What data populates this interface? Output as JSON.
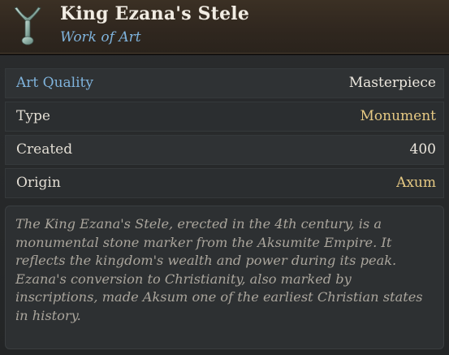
{
  "header": {
    "icon": "stele-monument-icon",
    "title": "King Ezana's Stele",
    "subtitle": "Work of Art"
  },
  "properties": [
    {
      "label": "Art Quality",
      "value": "Masterpiece"
    },
    {
      "label": "Type",
      "value": "Monument"
    },
    {
      "label": "Created",
      "value": "400"
    },
    {
      "label": "Origin",
      "value": "Axum"
    }
  ],
  "description": "The King Ezana's Stele, erected in the 4th century, is a monumental stone marker from the Aksumite Empire. It reflects the kingdom's wealth and power during its peak. Ezana's conversion to Christianity, also marked by inscriptions, made Aksum one of the earliest Christian states in history.",
  "colors": {
    "label_accent": "#7fb3dc",
    "value_gold": "#e6c983",
    "text_light": "#e2ddd3",
    "description_text": "#aaa59c"
  }
}
